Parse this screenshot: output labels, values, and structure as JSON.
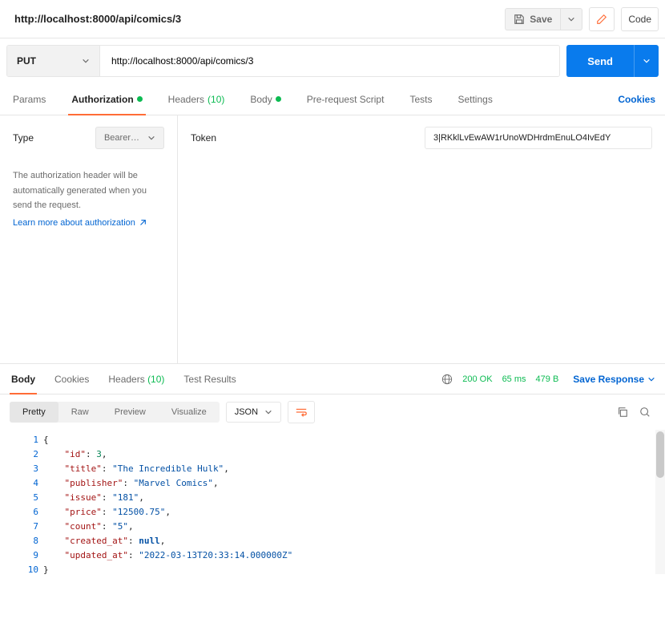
{
  "tab_title": "http://localhost:8000/api/comics/3",
  "top_buttons": {
    "save": "Save",
    "code": "Code"
  },
  "request": {
    "method": "PUT",
    "url": "http://localhost:8000/api/comics/3",
    "send": "Send"
  },
  "request_tabs": {
    "params": "Params",
    "authorization": "Authorization",
    "headers": "Headers",
    "headers_count": "(10)",
    "body": "Body",
    "prerequest": "Pre-request Script",
    "tests": "Tests",
    "settings": "Settings",
    "cookies": "Cookies"
  },
  "auth": {
    "type_label": "Type",
    "type_value": "Bearer…",
    "desc": "The authorization header will be automatically generated when you send the request.",
    "learn_more": "Learn more about authorization",
    "token_label": "Token",
    "token_value": "3|RKklLvEwAW1rUnoWDHrdmEnuLO4IvEdY"
  },
  "response_tabs": {
    "body": "Body",
    "cookies": "Cookies",
    "headers": "Headers",
    "headers_count": "(10)",
    "test_results": "Test Results",
    "save_response": "Save Response"
  },
  "response_status": {
    "status": "200 OK",
    "time": "65 ms",
    "size": "479 B"
  },
  "response_toolbar": {
    "pretty": "Pretty",
    "raw": "Raw",
    "preview": "Preview",
    "visualize": "Visualize",
    "format": "JSON"
  },
  "response_body": {
    "line1a": "\"id\"",
    "line1b": "3",
    "line2a": "\"title\"",
    "line2b": "\"The Incredible Hulk\"",
    "line3a": "\"publisher\"",
    "line3b": "\"Marvel Comics\"",
    "line4a": "\"issue\"",
    "line4b": "\"181\"",
    "line5a": "\"price\"",
    "line5b": "\"12500.75\"",
    "line6a": "\"count\"",
    "line6b": "\"5\"",
    "line7a": "\"created_at\"",
    "line7b": "null",
    "line8a": "\"updated_at\"",
    "line8b": "\"2022-03-13T20:33:14.000000Z\""
  },
  "gutter": [
    "1",
    "2",
    "3",
    "4",
    "5",
    "6",
    "7",
    "8",
    "9",
    "10"
  ]
}
